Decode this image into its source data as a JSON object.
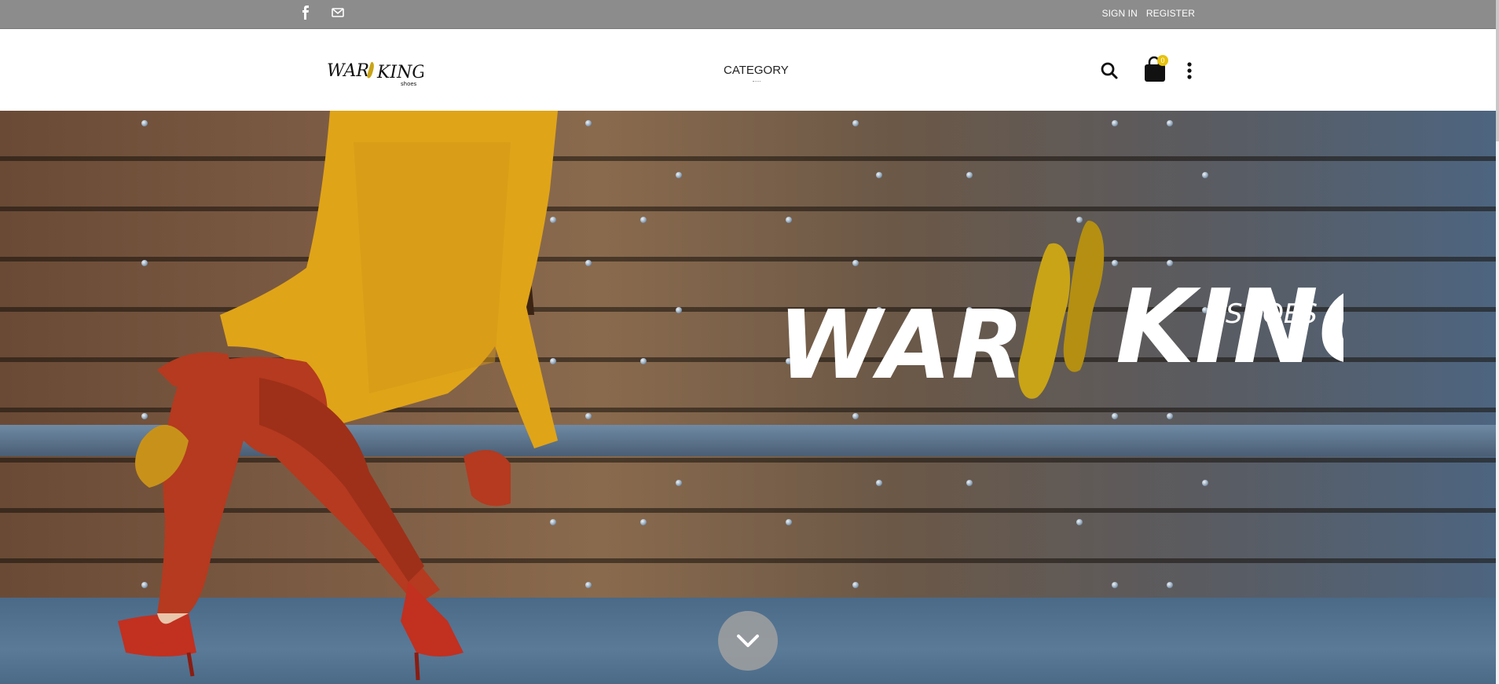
{
  "topbar": {
    "social": [
      {
        "icon": "facebook-icon"
      },
      {
        "icon": "mail-icon"
      }
    ],
    "auth": {
      "sign_in": "SIGN IN",
      "register": "REGISTER"
    }
  },
  "header": {
    "logo_text": "War King",
    "nav": {
      "category": "CATEGORY"
    },
    "icons": {
      "search": "search-icon",
      "cart": "shopping-bag-icon",
      "more": "more-vertical-icon"
    },
    "cart_count": "0"
  },
  "hero": {
    "brand_word_1": "WAR",
    "brand_word_2": "KING",
    "brand_sub": "SHOES",
    "scroll_icon": "chevron-down-icon"
  },
  "colors": {
    "topbar": "#8c8c8c",
    "accent": "#e6c20b",
    "pants": "#b53a1f",
    "sweater": "#e0a418"
  }
}
